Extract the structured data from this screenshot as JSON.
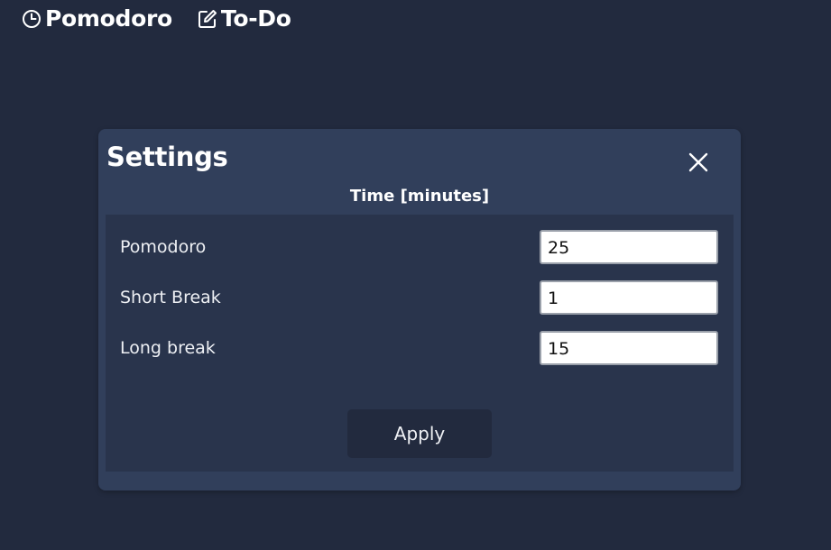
{
  "nav": {
    "items": [
      {
        "label": "Pomodoro",
        "icon": "clock-icon"
      },
      {
        "label": "To-Do",
        "icon": "edit-icon"
      }
    ]
  },
  "settings": {
    "title": "Settings",
    "close_icon": "close-icon",
    "section_heading": "Time [minutes]",
    "fields": [
      {
        "label": "Pomodoro",
        "value": "25"
      },
      {
        "label": "Short Break",
        "value": "1"
      },
      {
        "label": "Long break",
        "value": "15"
      }
    ],
    "apply_label": "Apply"
  },
  "colors": {
    "background": "#222a3e",
    "modal": "#313f5b",
    "panel": "#29344c",
    "button": "#222a3e"
  }
}
